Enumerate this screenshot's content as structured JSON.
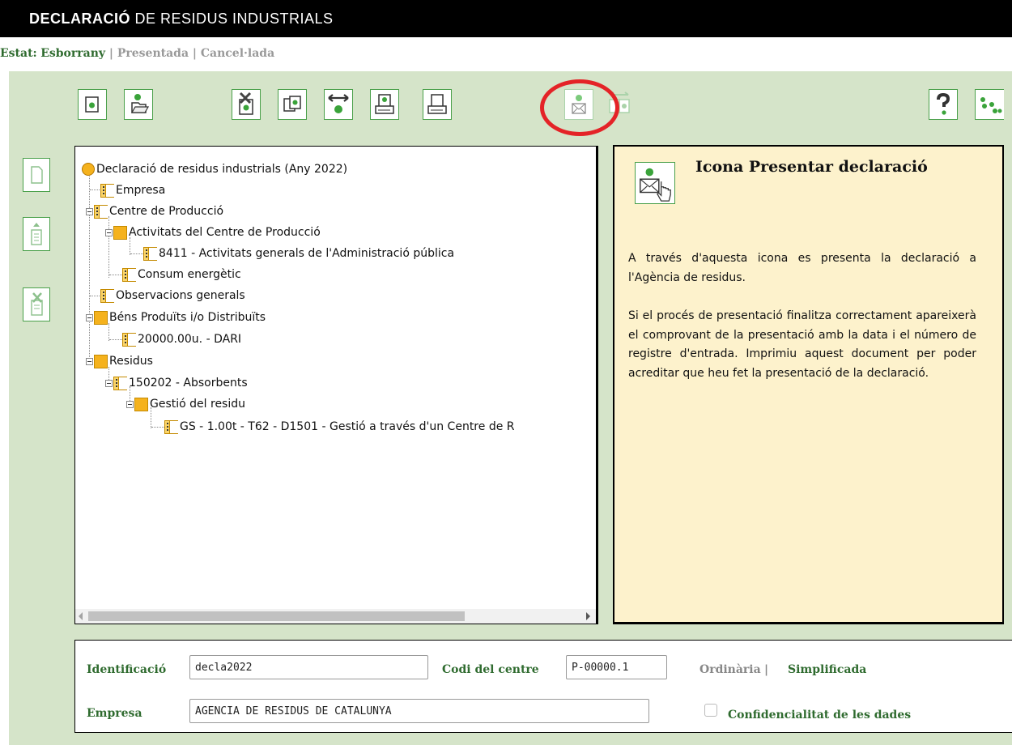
{
  "header": {
    "title_bold": "DECLARACIÓ",
    "title_rest": " DE RESIDUS INDUSTRIALS"
  },
  "status": {
    "label": "Estat:",
    "current": "Esborrany",
    "sep1": " | ",
    "other1": "Presentada",
    "sep2": "  | ",
    "other2": "Cancel·lada"
  },
  "tree": {
    "root": "Declaració de residus industrials (Any 2022)",
    "empresa": "Empresa",
    "centre": "Centre de Producció",
    "activitats": "Activitats del Centre de Producció",
    "activitat_1": "8411 - Activitats generals de l'Administració pública",
    "consum": "Consum energètic",
    "observacions": "Observacions generals",
    "bens": "Béns Produïts i/o Distribuïts",
    "bens_1": "20000.00u. - DARI",
    "residus": "Residus",
    "residu_1": "150202 - Absorbents",
    "gestio": "Gestió del residu",
    "gestio_1": "GS - 1.00t - T62 - D1501 - Gestió a través d'un Centre de R"
  },
  "help": {
    "title": "Icona Presentar declaració",
    "p1": "A través d'aquesta icona es presenta la declaració a l'Agència de residus.",
    "p2": "Si el procés de presentació finalitza correctament apareixerà el comprovant de la presentació amb la data i el número de registre d'entrada. Imprimiu aquest document per poder acreditar que heu fet la presentació de la declaració."
  },
  "form": {
    "id_label": "Identificació",
    "id_value": "decla2022",
    "codi_label": "Codi del centre",
    "codi_value": "P-00000.1",
    "ordinaria": "Ordinària",
    "tipus_sep": " | ",
    "simplificada": "Simplificada",
    "empresa_label": "Empresa",
    "empresa_value": "AGENCIA DE RESIDUS DE CATALUNYA",
    "confidencial_label": "Confidencialitat de les dades"
  },
  "icons": {
    "toolbar": [
      "new-declaration-icon",
      "open-folder-icon",
      "delete-node-icon",
      "copy-icon",
      "move-node-icon",
      "print-preview-icon",
      "print-icon",
      "submit-declaration-icon",
      "transfer-icon",
      "help-icon",
      "footsteps-icon"
    ],
    "side": [
      "blank-page-icon",
      "upload-doc-icon",
      "delete-doc-icon"
    ]
  },
  "colors": {
    "accent_green": "#2f6b2f",
    "border_green": "#4aa04a",
    "workspace_bg": "#d5e4c9",
    "help_bg": "#fdf2cc",
    "highlight_red": "#e42327"
  }
}
